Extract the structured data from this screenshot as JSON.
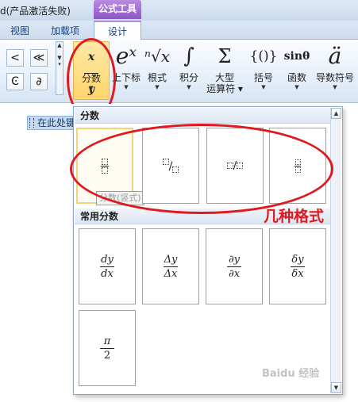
{
  "window": {
    "doc_title": "d(产品激活失败)",
    "context_tab": "公式工具"
  },
  "tabs": [
    {
      "label": "视图"
    },
    {
      "label": "加载项"
    },
    {
      "label": "设计"
    }
  ],
  "symbol_panel": {
    "row1": [
      "<",
      "≪"
    ],
    "row2": [
      "Ͼ",
      "∂"
    ]
  },
  "ribbon_buttons": [
    {
      "label": "分数",
      "glyph": "x/y"
    },
    {
      "label": "上下标",
      "glyph": "eˣ"
    },
    {
      "label": "根式",
      "glyph": "ⁿ√x"
    },
    {
      "label": "积分",
      "glyph": "∫"
    },
    {
      "label": "大型",
      "label2": "运算符",
      "glyph": "Σ"
    },
    {
      "label": "括号",
      "glyph": "{()}"
    },
    {
      "label": "函数",
      "glyph": "sinθ"
    },
    {
      "label": "导数符号",
      "glyph": "ä"
    }
  ],
  "gallery": {
    "section1_title": "分数",
    "section2_title": "常用分数",
    "tooltip": "分数(竖式)",
    "common": [
      {
        "num": "dy",
        "den": "dx"
      },
      {
        "num": "Δy",
        "den": "Δx"
      },
      {
        "num": "∂y",
        "den": "∂x"
      },
      {
        "num": "δy",
        "den": "δx"
      },
      {
        "num": "π",
        "den": "2"
      }
    ]
  },
  "document": {
    "placeholder": "在此处键入公式。"
  },
  "annotation": {
    "text": "几种格式"
  },
  "watermark": "Baidu 经验",
  "colors": {
    "context_tab": "#9b5fd0",
    "annotation_red": "#e0191e",
    "selected_button": "#ffd56b"
  }
}
